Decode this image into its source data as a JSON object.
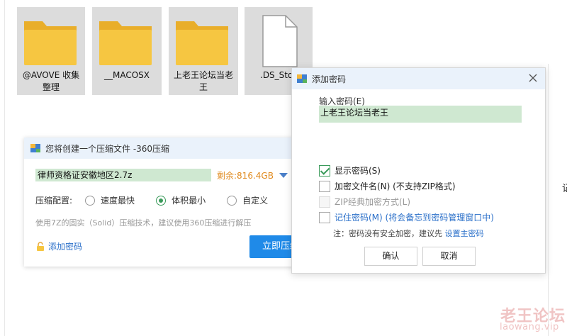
{
  "files": [
    {
      "name": "@AVOVE 收集\n整理",
      "type": "folder"
    },
    {
      "name": "__MACOSX",
      "type": "folder"
    },
    {
      "name": "上老王论坛当老\n王",
      "type": "folder"
    },
    {
      "name": ".DS_Sto",
      "type": "file"
    }
  ],
  "compress": {
    "title": "您将创建一个压缩文件 -360压缩",
    "path": "律师资格证安徽地区2.7z",
    "free_space": "剩余:816.4GB",
    "config_label": "压缩配置:",
    "options": [
      "速度最快",
      "体积最小",
      "自定义"
    ],
    "selected_option": "体积最小",
    "hint": "使用7Z的固实（Solid）压缩技术，建议使用360压缩进行解压",
    "add_password": "添加密码",
    "start_button": "立即压缩"
  },
  "password_dialog": {
    "title": "添加密码",
    "input_label": "输入密码(E)",
    "input_value": "上老王论坛当老王",
    "show_password": {
      "label": "显示密码(S)",
      "checked": true
    },
    "encrypt_names": {
      "label": "加密文件名(N) (不支持ZIP格式)",
      "checked": false
    },
    "zip_classic": {
      "label": "ZIP经典加密方式(L)",
      "checked": false,
      "disabled": true
    },
    "remember": {
      "label": "记住密码(M) (将会备忘到密码管理窗口中)",
      "checked": false
    },
    "note": "注：密码没有安全加密，建议先",
    "note_link": "设置主密码",
    "ok": "确认",
    "cancel": "取消"
  },
  "edge_char": "记",
  "watermark": {
    "name": "老王论坛",
    "url": "laowang.vip"
  },
  "colors": {
    "accent": "#1f8ae8",
    "folder": "#f6c641",
    "highlight": "#cfe8d1",
    "link": "#2a6fc9"
  }
}
